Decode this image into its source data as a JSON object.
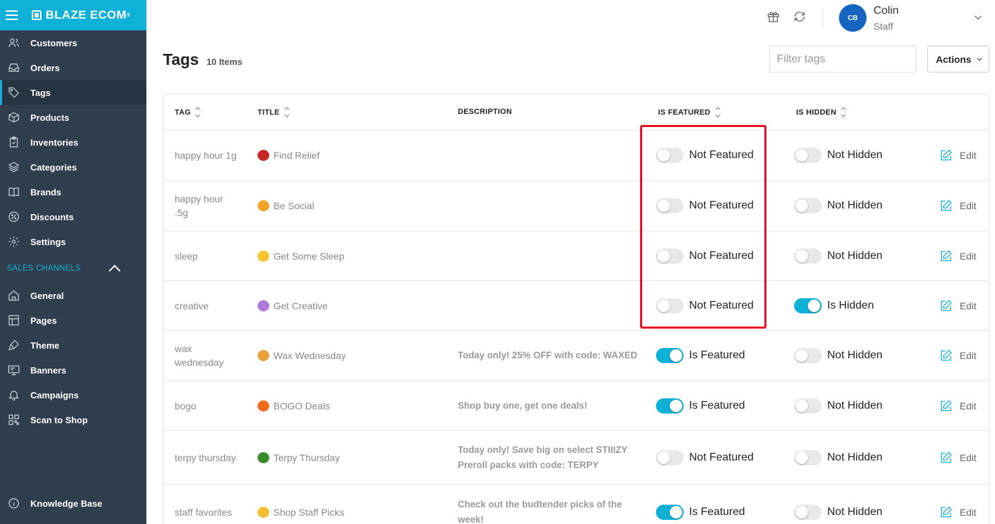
{
  "brand": {
    "name": "BLAZE ECOM",
    "reg": "®"
  },
  "sidebar": {
    "items": [
      {
        "label": "Customers",
        "icon": "users-icon",
        "active": false
      },
      {
        "label": "Orders",
        "icon": "inbox-icon",
        "active": false
      },
      {
        "label": "Tags",
        "icon": "tag-icon",
        "active": true
      },
      {
        "label": "Products",
        "icon": "box-icon",
        "active": false
      },
      {
        "label": "Inventories",
        "icon": "clipboard-icon",
        "active": false
      },
      {
        "label": "Categories",
        "icon": "layers-icon",
        "active": false
      },
      {
        "label": "Brands",
        "icon": "book-icon",
        "active": false
      },
      {
        "label": "Discounts",
        "icon": "percent-icon",
        "active": false
      },
      {
        "label": "Settings",
        "icon": "gear-icon",
        "active": false
      }
    ],
    "section_label": "SALES CHANNELS",
    "channel_items": [
      {
        "label": "General",
        "icon": "home-icon"
      },
      {
        "label": "Pages",
        "icon": "layout-icon"
      },
      {
        "label": "Theme",
        "icon": "brush-icon"
      },
      {
        "label": "Banners",
        "icon": "monitor-icon"
      },
      {
        "label": "Campaigns",
        "icon": "bell-icon"
      },
      {
        "label": "Scan to Shop",
        "icon": "qr-icon"
      }
    ],
    "footer_item": {
      "label": "Knowledge Base",
      "icon": "info-icon"
    }
  },
  "header": {
    "user_initials": "CB",
    "user_name": "Colin",
    "user_role": "Staff"
  },
  "page": {
    "title": "Tags",
    "count": "10 Items",
    "filter_placeholder": "Filter tags",
    "actions_label": "Actions"
  },
  "table": {
    "columns": {
      "tag": "TAG",
      "title": "TITLE",
      "description": "DESCRIPTION",
      "featured": "IS FEATURED",
      "hidden": "IS HIDDEN"
    },
    "edit_label": "Edit",
    "rows": [
      {
        "tag": "happy hour 1g",
        "emoji_color": "#c62828",
        "title": "Find Relief",
        "description": "",
        "featured": false,
        "featured_label": "Not Featured",
        "hidden": false,
        "hidden_label": "Not Hidden"
      },
      {
        "tag": "happy hour .5g",
        "emoji_color": "#f2a428",
        "title": "Be Social",
        "description": "",
        "featured": false,
        "featured_label": "Not Featured",
        "hidden": false,
        "hidden_label": "Not Hidden"
      },
      {
        "tag": "sleep",
        "emoji_color": "#f7c531",
        "title": "Get Some Sleep",
        "description": "",
        "featured": false,
        "featured_label": "Not Featured",
        "hidden": false,
        "hidden_label": "Not Hidden"
      },
      {
        "tag": "creative",
        "emoji_color": "#b07ad9",
        "title": "Get Creative",
        "description": "",
        "featured": false,
        "featured_label": "Not Featured",
        "hidden": true,
        "hidden_label": "Is Hidden"
      },
      {
        "tag": "wax wednesday",
        "emoji_color": "#e8a13a",
        "title": "Wax Wednesday",
        "description": "Today only! 25% OFF with code: WAXED",
        "featured": true,
        "featured_label": "Is Featured",
        "hidden": false,
        "hidden_label": "Not Hidden"
      },
      {
        "tag": "bogo",
        "emoji_color": "#f26b1d",
        "title": "BOGO Deals",
        "description": "Shop buy one, get one deals!",
        "featured": true,
        "featured_label": "Is Featured",
        "hidden": false,
        "hidden_label": "Not Hidden"
      },
      {
        "tag": "terpy thursday",
        "emoji_color": "#3b8c2f",
        "title": "Terpy Thursday",
        "description": "Today only! Save big on select STIIIZY Preroll packs with code: TERPY",
        "featured": false,
        "featured_label": "Not Featured",
        "hidden": false,
        "hidden_label": "Not Hidden"
      },
      {
        "tag": "staff favorites",
        "emoji_color": "#f5bf33",
        "title": "Shop Staff Picks",
        "description": "Check out the budtender picks of the week!",
        "featured": true,
        "featured_label": "Is Featured",
        "hidden": false,
        "hidden_label": "Not Hidden"
      }
    ]
  }
}
